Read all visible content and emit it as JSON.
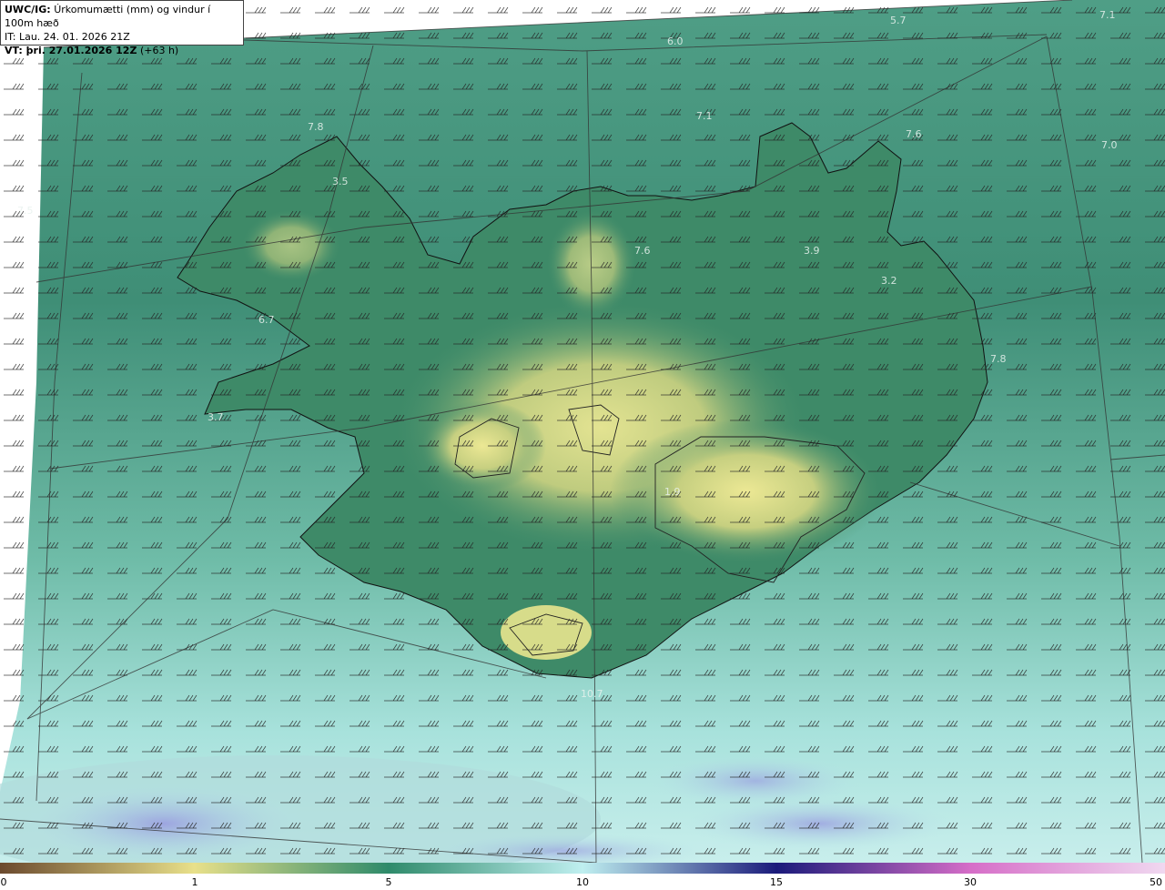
{
  "header": {
    "model": "UWC/IG:",
    "description": "Úrkomumætti (mm) og vindur í 100m hæð",
    "init_time": "IT: Lau. 24. 01. 2026 21Z",
    "valid_prefix": "VT: þri. 27.01.2026 12Z",
    "valid_offset": "(+63 h)"
  },
  "map_labels": [
    {
      "id": "v1",
      "text": "5.7"
    },
    {
      "id": "v2",
      "text": "7.1"
    },
    {
      "id": "v3",
      "text": "6.0"
    },
    {
      "id": "v4",
      "text": "7.1"
    },
    {
      "id": "v5",
      "text": "7.6"
    },
    {
      "id": "v6",
      "text": "7.0"
    },
    {
      "id": "v7",
      "text": "7.8"
    },
    {
      "id": "v8",
      "text": "3.5"
    },
    {
      "id": "v9",
      "text": "7.5"
    },
    {
      "id": "v10",
      "text": "3.9"
    },
    {
      "id": "v11",
      "text": "3.2"
    },
    {
      "id": "v12",
      "text": "7.6"
    },
    {
      "id": "v13",
      "text": "6.7"
    },
    {
      "id": "v14",
      "text": "3.7"
    },
    {
      "id": "v15",
      "text": "7.8"
    },
    {
      "id": "v16",
      "text": "10.7"
    },
    {
      "id": "v17",
      "text": "1.9"
    }
  ],
  "colorbar": {
    "ticks": [
      "0",
      "1",
      "5",
      "10",
      "15",
      "30",
      "50"
    ],
    "stops": [
      {
        "value": 0,
        "color": "#6b4a2e"
      },
      {
        "value": 1,
        "color": "#e8e08a"
      },
      {
        "value": 5,
        "color": "#2e8a6a"
      },
      {
        "value": 10,
        "color": "#bfeff0"
      },
      {
        "value": 15,
        "color": "#1a1a7a"
      },
      {
        "value": 30,
        "color": "#d66ec8"
      },
      {
        "value": 50,
        "color": "#f0d8f0"
      }
    ]
  },
  "colors": {
    "sea_base": "#5fae98",
    "land_high": "#e8e48e",
    "land_mid": "#3c8c6a",
    "south_sea_light": "#b6e8e4",
    "south_sea_purple": "#a6a6e0"
  }
}
